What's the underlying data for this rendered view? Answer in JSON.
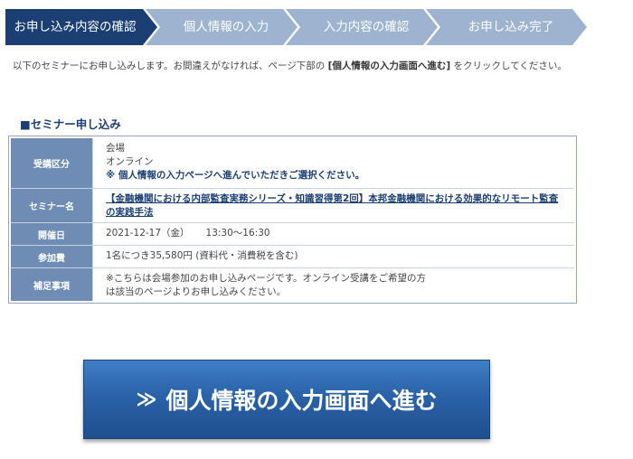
{
  "steps": [
    {
      "label": "お申し込み内容の確認",
      "active": true
    },
    {
      "label": "個人情報の入力",
      "active": false
    },
    {
      "label": "入力内容の確認",
      "active": false
    },
    {
      "label": "お申し込み完了",
      "active": false
    }
  ],
  "intro": {
    "before": "以下のセミナーにお申し込みします。お間違えがなければ、ページ下部の",
    "bold": "[個人情報の入力画面へ進む]",
    "after": "をクリックしてください。"
  },
  "section_title": "■セミナー申し込み",
  "table": {
    "attendance": {
      "label": "受講区分",
      "option1": "会場",
      "option2": "オンライン",
      "note": "※ 個人情報の入力ページへ進んでいただきご選択ください。"
    },
    "seminar": {
      "label": "セミナー名",
      "title": "【金融機関における内部監査実務シリーズ・知識習得第2回】本邦金融機関における効果的なリモート監査の実践手法"
    },
    "date": {
      "label": "開催日",
      "day": "2021-12-17（金）",
      "time": "13:30～16:30"
    },
    "fee": {
      "label": "参加費",
      "value": "1名につき35,580円 (資料代・消費税を含む)"
    },
    "notes": {
      "label": "補足事項",
      "line1": "※こちらは会場参加のお申し込みページです。オンライン受講をご希望の方",
      "line2": "は該当のページよりお申し込みください。"
    }
  },
  "cta": {
    "chevron": "≫",
    "label": "個人情報の入力画面へ進む"
  },
  "colors": {
    "active_step": "#1c3f73",
    "inactive_step": "#9db3cf",
    "table_header": "#6f8db4",
    "cta": "#2a62a8"
  }
}
